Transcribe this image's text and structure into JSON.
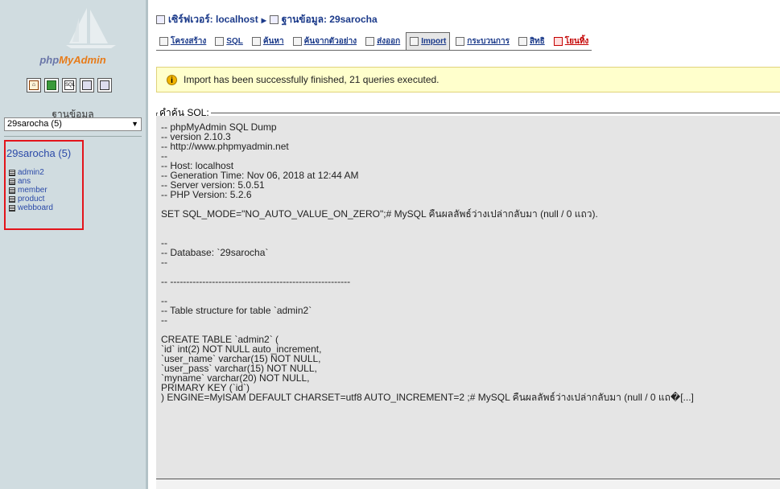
{
  "sidebar": {
    "logo_text_1": "php",
    "logo_text_2": "MyAdmin",
    "nav_icons": [
      "home-icon",
      "query-window-icon",
      "sql-icon",
      "docs-icon",
      "changelog-icon"
    ],
    "database_label": "ฐานข้อมูล",
    "database_select_value": "29sarocha (5)",
    "db_title": "29sarocha (5)",
    "tables": [
      "admin2",
      "ans",
      "member",
      "product",
      "webboard"
    ]
  },
  "breadcrumb": {
    "server": "เซิร์ฟเวอร์: localhost",
    "separator": "▸",
    "database": "ฐานข้อมูล: 29sarocha"
  },
  "tabs": [
    {
      "label": "โครงสร้าง",
      "icon": "structure-icon"
    },
    {
      "label": "SQL",
      "icon": "sql-icon"
    },
    {
      "label": "ค้นหา",
      "icon": "search-icon"
    },
    {
      "label": "ค้นจากตัวอย่าง",
      "icon": "query-icon"
    },
    {
      "label": "ส่งออก",
      "icon": "export-icon"
    },
    {
      "label": "Import",
      "icon": "import-icon"
    },
    {
      "label": "กระบวนการ",
      "icon": "operations-icon"
    },
    {
      "label": "สิทธิ",
      "icon": "privileges-icon"
    },
    {
      "label": "โยนทิ้ง",
      "icon": "drop-icon"
    }
  ],
  "active_tab": "Import",
  "notice": {
    "text": "Import has been successfully finished, 21 queries executed."
  },
  "sql": {
    "legend": "คำค้น SQL:",
    "lines": [
      "-- phpMyAdmin SQL Dump",
      "-- version 2.10.3",
      "-- http://www.phpmyadmin.net",
      "--",
      "-- Host: localhost",
      "-- Generation Time: Nov 06, 2018 at 12:44 AM",
      "-- Server version: 5.0.51",
      "-- PHP Version: 5.2.6",
      "",
      "SET SQL_MODE=\"NO_AUTO_VALUE_ON_ZERO\";# MySQL คืนผลลัพธ์ว่างเปล่ากลับมา (null / 0 แถว).",
      "",
      "",
      "--",
      "-- Database: `29sarocha`",
      "--",
      "",
      "-- --------------------------------------------------------",
      "",
      "--",
      "-- Table structure for table `admin2`",
      "--",
      "",
      "CREATE TABLE `admin2` (",
      "`id` int(2) NOT NULL auto_increment,",
      "`user_name` varchar(15) NOT NULL,",
      "`user_pass` varchar(15) NOT NULL,",
      "`myname` varchar(20) NOT NULL,",
      "PRIMARY KEY (`id`)",
      ") ENGINE=MyISAM DEFAULT CHARSET=utf8 AUTO_INCREMENT=2 ;# MySQL คืนผลลัพธ์ว่างเปล่ากลับมา (null / 0 แถ�[...]"
    ]
  }
}
